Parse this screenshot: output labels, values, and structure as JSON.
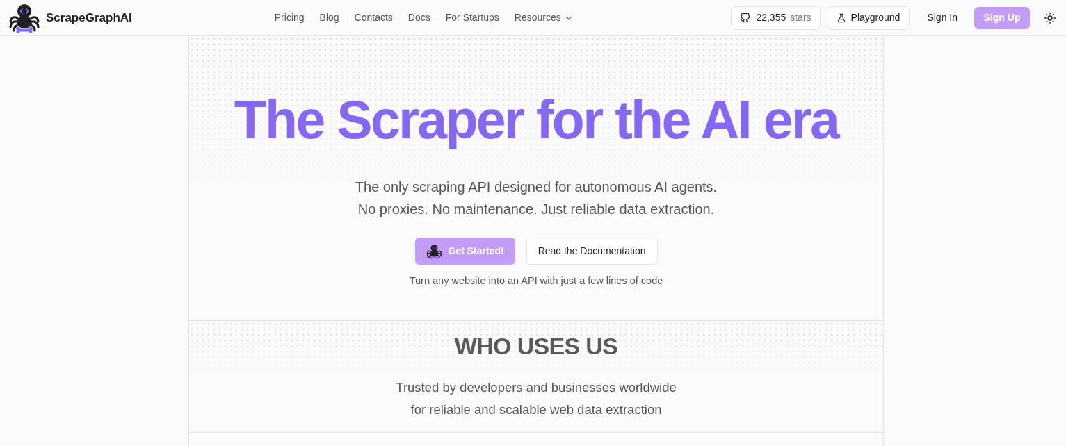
{
  "header": {
    "brand": "ScrapeGraphAI",
    "nav": [
      {
        "label": "Pricing",
        "kind": "link"
      },
      {
        "label": "Blog",
        "kind": "link"
      },
      {
        "label": "Contacts",
        "kind": "link"
      },
      {
        "label": "Docs",
        "kind": "link"
      },
      {
        "label": "For Startups",
        "kind": "link"
      },
      {
        "label": "Resources",
        "kind": "dropdown"
      }
    ],
    "github": {
      "count": "22,355",
      "unit": "stars"
    },
    "playground": "Playground",
    "sign_in": "Sign In",
    "sign_up": "Sign Up"
  },
  "hero": {
    "title": "The Scraper for the AI era",
    "subtitle_lines": [
      "The only scraping API designed for autonomous AI agents.",
      "No proxies. No maintenance. Just reliable data extraction."
    ],
    "buttons": [
      {
        "label": "Get Started!",
        "kind": "primary"
      },
      {
        "label": "Read the Documentation",
        "kind": "secondary"
      }
    ],
    "caption": "Turn any website into an API with just a few lines of code"
  },
  "who_uses_us": {
    "title": "WHO USES US",
    "lines": [
      "Trusted by developers and businesses worldwide",
      "for reliable and scalable web data extraction"
    ]
  }
}
